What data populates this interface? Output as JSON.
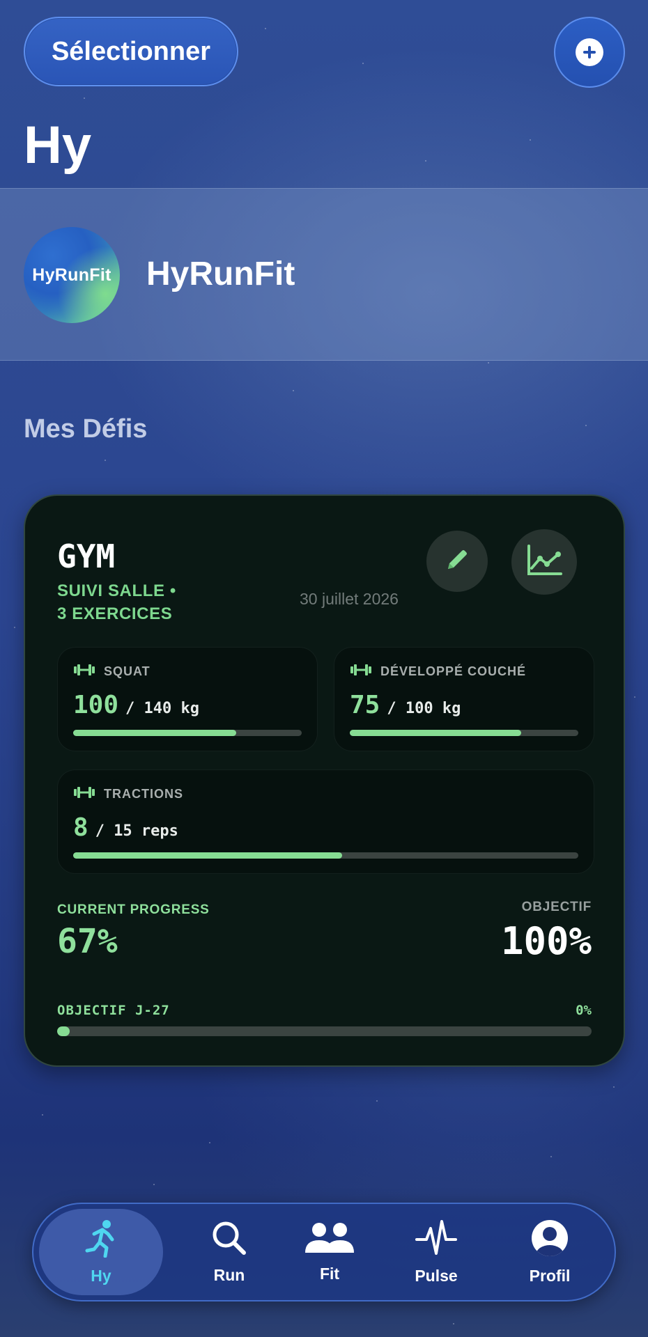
{
  "header": {
    "select_label": "Sélectionner",
    "add_icon": "plus-circle-icon",
    "title": "Hy"
  },
  "group": {
    "avatar_text": "HyRunFit",
    "name": "HyRunFit"
  },
  "section_title": "Mes Défis",
  "challenge": {
    "title": "GYM",
    "subtitle_line1": "SUIVI SALLE •",
    "subtitle_line2": "3 EXERCICES",
    "date": "30 juillet 2026",
    "exercises": [
      {
        "name": "SQUAT",
        "current": "100",
        "goal": "/ 140 kg",
        "progress": 0.714
      },
      {
        "name": "DÉVELOPPÉ COUCHÉ",
        "current": "75",
        "goal": "/ 100 kg",
        "progress": 0.75
      },
      {
        "name": "TRACTIONS",
        "current": "8",
        "goal": "/ 15 reps",
        "progress": 0.533
      }
    ],
    "current_progress_label": "CURRENT PROGRESS",
    "current_progress_value": "67%",
    "objective_label": "OBJECTIF",
    "objective_value": "100%",
    "deadline_label": "OBJECTIF J-27",
    "deadline_percent": "0%",
    "deadline_progress": 0.0
  },
  "tabs": [
    {
      "label": "Hy",
      "icon": "running-person-icon",
      "active": true
    },
    {
      "label": "Run",
      "icon": "search-icon",
      "active": false
    },
    {
      "label": "Fit",
      "icon": "people-icon",
      "active": false
    },
    {
      "label": "Pulse",
      "icon": "heartbeat-icon",
      "active": false
    },
    {
      "label": "Profil",
      "icon": "profile-icon",
      "active": false
    }
  ],
  "colors": {
    "accent_green": "#86dc93",
    "active_tab_text": "#4fd7f0",
    "card_bg": "#0a1814",
    "background": "#2b4590"
  }
}
